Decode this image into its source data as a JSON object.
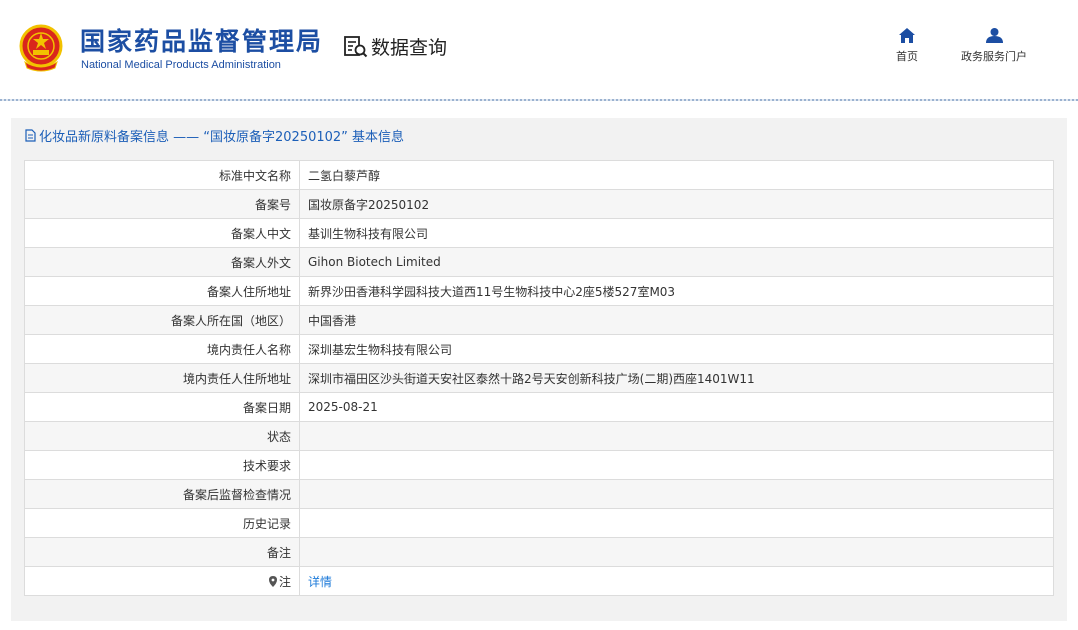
{
  "header": {
    "agency_cn": "国家药品监督管理局",
    "agency_en": "National Medical Products Administration",
    "data_query": "数据查询",
    "nav": {
      "home": "首页",
      "portal": "政务服务门户"
    }
  },
  "panel": {
    "title": "化妆品新原料备案信息 —— “国妆原备字20250102” 基本信息"
  },
  "rows": [
    {
      "label": "标准中文名称",
      "value": "二氢白藜芦醇"
    },
    {
      "label": "备案号",
      "value": "国妆原备字20250102"
    },
    {
      "label": "备案人中文",
      "value": "基训生物科技有限公司"
    },
    {
      "label": "备案人外文",
      "value": "Gihon Biotech Limited"
    },
    {
      "label": "备案人住所地址",
      "value": "新界沙田香港科学园科技大道西11号生物科技中心2座5楼527室M03"
    },
    {
      "label": "备案人所在国（地区）",
      "value": "中国香港"
    },
    {
      "label": "境内责任人名称",
      "value": "深圳基宏生物科技有限公司"
    },
    {
      "label": "境内责任人住所地址",
      "value": "深圳市福田区沙头街道天安社区泰然十路2号天安创新科技广场(二期)西座1401W11"
    },
    {
      "label": "备案日期",
      "value": "2025-08-21"
    },
    {
      "label": "状态",
      "value": ""
    },
    {
      "label": "技术要求",
      "value": ""
    },
    {
      "label": "备案后监督检查情况",
      "value": ""
    },
    {
      "label": "历史记录",
      "value": ""
    },
    {
      "label": "备注",
      "value": ""
    }
  ],
  "note_row": {
    "label": "注",
    "link": "详情"
  },
  "colors": {
    "brand_blue": "#1c4ea3",
    "link_blue": "#1c7ad9",
    "emblem_red": "#d9261c",
    "emblem_gold": "#f2c200"
  }
}
